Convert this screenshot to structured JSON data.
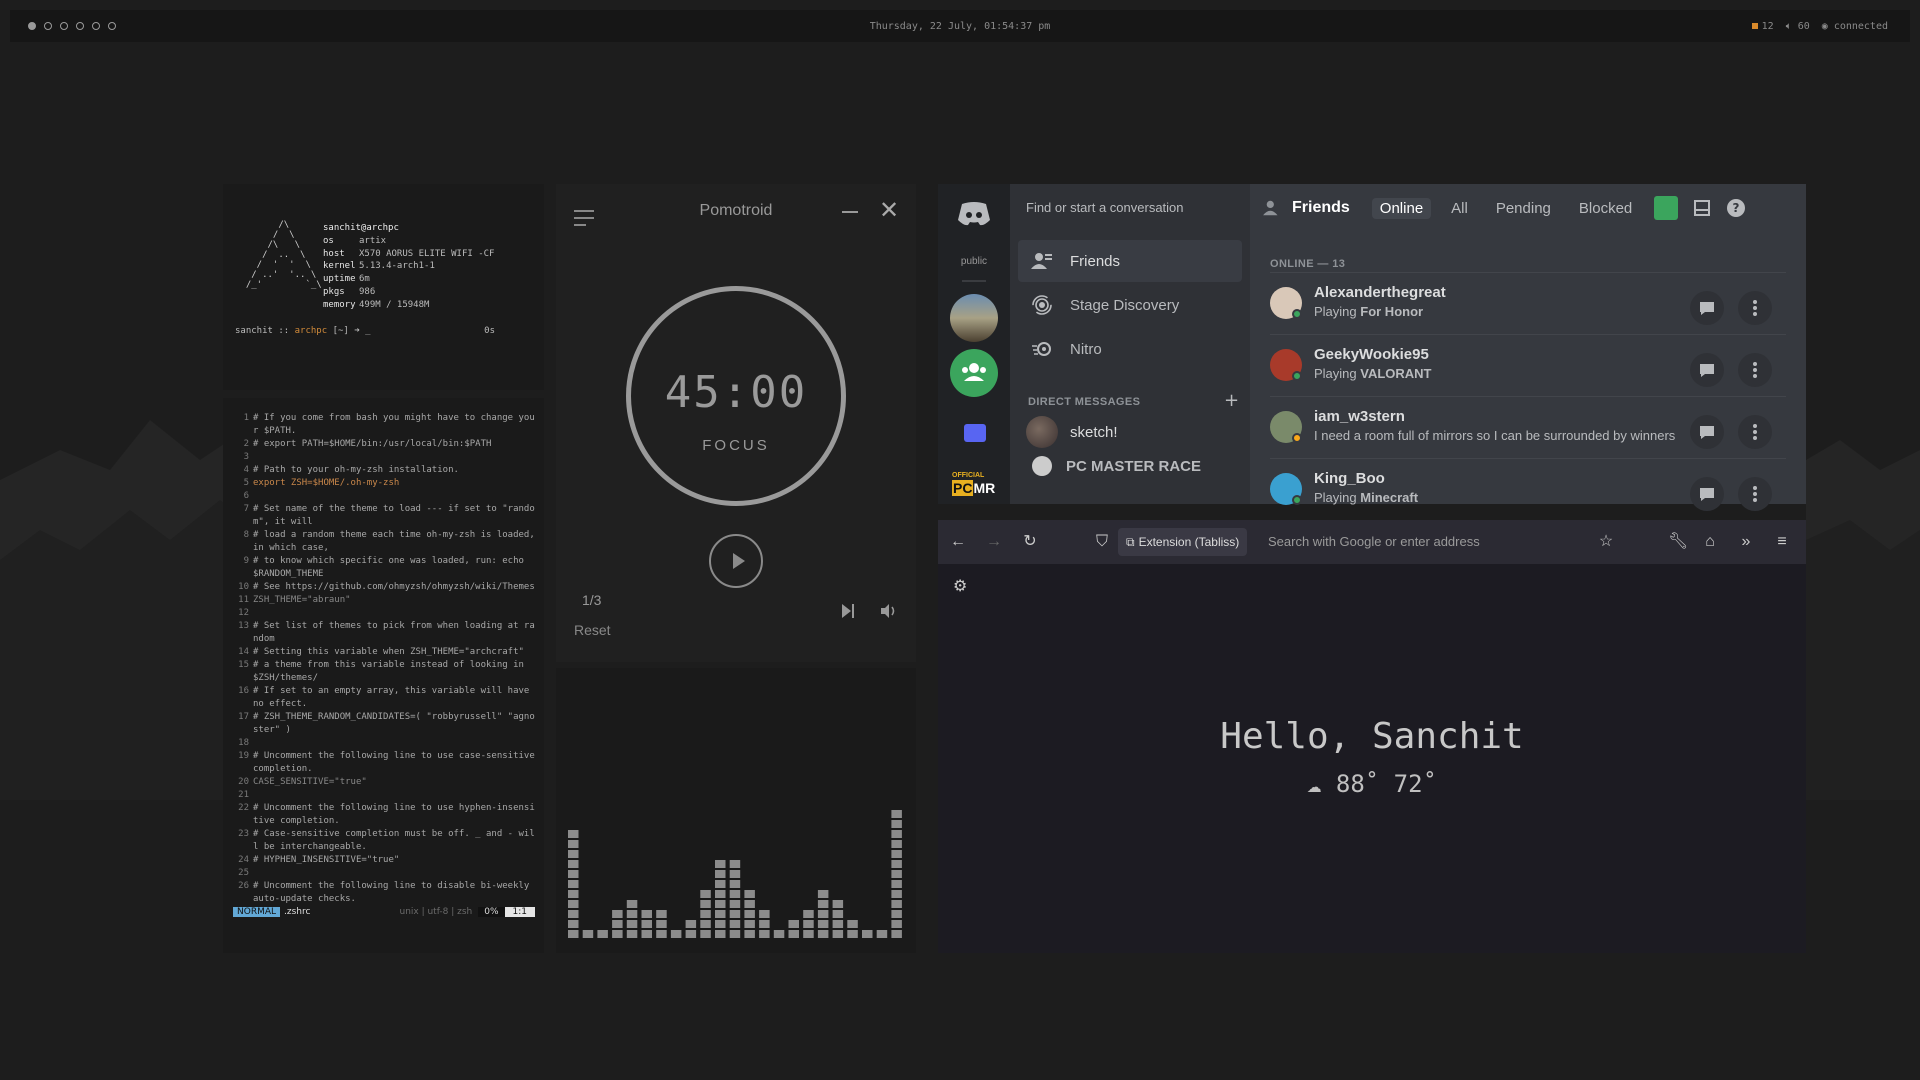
{
  "topbar": {
    "datetime": "Thursday, 22 July, 01:54:37 pm",
    "tray": {
      "updates": "12",
      "volume": "60",
      "network": "connected"
    },
    "workspaces": [
      {
        "active": true
      },
      {
        "active": false
      },
      {
        "active": false
      },
      {
        "active": false
      },
      {
        "active": false
      },
      {
        "active": false
      }
    ]
  },
  "neofetch": {
    "user": "sanchit@archpc",
    "info": [
      {
        "key": "os",
        "value": "artix"
      },
      {
        "key": "host",
        "value": "X570 AORUS ELITE WIFI -CF"
      },
      {
        "key": "kernel",
        "value": "5.13.4-arch1-1"
      },
      {
        "key": "uptime",
        "value": "6m"
      },
      {
        "key": "pkgs",
        "value": "986"
      },
      {
        "key": "memory",
        "value": "499M / 15948M"
      }
    ],
    "prompt_user": "sanchit",
    "prompt_sep": "::",
    "prompt_host": "archpc",
    "prompt_dir": "[~] ➜ _",
    "prompt_time": "0s"
  },
  "vim": {
    "lines": [
      {
        "n": "1",
        "t": "# If you come from bash you might have to change your $PATH.",
        "c": "comment"
      },
      {
        "n": "2",
        "t": "# export PATH=$HOME/bin:/usr/local/bin:$PATH",
        "c": "comment"
      },
      {
        "n": "3",
        "t": "",
        "c": "comment"
      },
      {
        "n": "4",
        "t": "# Path to your oh-my-zsh installation.",
        "c": "comment"
      },
      {
        "n": "5",
        "t": "export ZSH=$HOME/.oh-my-zsh",
        "c": "code"
      },
      {
        "n": "6",
        "t": "",
        "c": "comment"
      },
      {
        "n": "7",
        "t": "# Set name of the theme to load --- if set to \"random\", it will",
        "c": "comment"
      },
      {
        "n": "8",
        "t": "# load a random theme each time oh-my-zsh is loaded, in which case,",
        "c": "comment"
      },
      {
        "n": "9",
        "t": "# to know which specific one was loaded, run: echo $RANDOM_THEME",
        "c": "comment"
      },
      {
        "n": "10",
        "t": "# See https://github.com/ohmyzsh/ohmyzsh/wiki/Themes",
        "c": "comment"
      },
      {
        "n": "11",
        "t": "ZSH_THEME=\"abraun\"",
        "c": "str"
      },
      {
        "n": "12",
        "t": "",
        "c": "comment"
      },
      {
        "n": "13",
        "t": "# Set list of themes to pick from when loading at random",
        "c": "comment"
      },
      {
        "n": "14",
        "t": "# Setting this variable when ZSH_THEME=\"archcraft\"",
        "c": "comment"
      },
      {
        "n": "15",
        "t": "# a theme from this variable instead of looking in $ZSH/themes/",
        "c": "comment"
      },
      {
        "n": "16",
        "t": "# If set to an empty array, this variable will have no effect.",
        "c": "comment"
      },
      {
        "n": "17",
        "t": "# ZSH_THEME_RANDOM_CANDIDATES=( \"robbyrussell\" \"agnoster\" )",
        "c": "comment"
      },
      {
        "n": "18",
        "t": "",
        "c": "comment"
      },
      {
        "n": "19",
        "t": "# Uncomment the following line to use case-sensitive completion.",
        "c": "comment"
      },
      {
        "n": "20",
        "t": "CASE_SENSITIVE=\"true\"",
        "c": "str"
      },
      {
        "n": "21",
        "t": "",
        "c": "comment"
      },
      {
        "n": "22",
        "t": "# Uncomment the following line to use hyphen-insensitive completion.",
        "c": "comment"
      },
      {
        "n": "23",
        "t": "# Case-sensitive completion must be off. _ and - will be interchangeable.",
        "c": "comment"
      },
      {
        "n": "24",
        "t": "# HYPHEN_INSENSITIVE=\"true\"",
        "c": "comment"
      },
      {
        "n": "25",
        "t": "",
        "c": "comment"
      },
      {
        "n": "26",
        "t": "# Uncomment the following line to disable bi-weekly auto-update checks.",
        "c": "comment"
      }
    ],
    "status": {
      "mode": "NORMAL",
      "file": ".zshrc",
      "enc": "unix | utf-8 | zsh",
      "pct": "0%",
      "pos": "1:1"
    }
  },
  "pomotroid": {
    "title": "Pomotroid",
    "time": "45:00",
    "label": "FOCUS",
    "round": "1/3",
    "reset": "Reset"
  },
  "visualizer": {
    "levels": [
      11,
      1,
      1,
      3,
      4,
      3,
      3,
      1,
      2,
      5,
      8,
      8,
      5,
      3,
      1,
      2,
      3,
      5,
      4,
      2,
      1,
      1,
      13
    ]
  },
  "discord": {
    "server_label": "public",
    "search": "Find or start a conversation",
    "nav": [
      {
        "label": "Friends",
        "icon": "friends-icon"
      },
      {
        "label": "Stage Discovery",
        "icon": "stage-icon"
      },
      {
        "label": "Nitro",
        "icon": "nitro-icon"
      }
    ],
    "dm_header": "DIRECT MESSAGES",
    "dms": [
      {
        "name": "sketch!"
      },
      {
        "name": "PC MASTER RACE"
      }
    ],
    "pcmr": {
      "top": "OFFICIAL",
      "pc": "PC",
      "mr": "MR"
    },
    "header": {
      "title": "Friends",
      "tabs": [
        "Online",
        "All",
        "Pending",
        "Blocked"
      ]
    },
    "online_label": "ONLINE — 13",
    "friends": [
      {
        "name": "Alexanderthegreat",
        "status_prefix": "Playing ",
        "status_bold": "For Honor",
        "status_plain": "",
        "dot": "#3ba55d"
      },
      {
        "name": "GeekyWookie95",
        "status_prefix": "Playing ",
        "status_bold": "VALORANT",
        "status_plain": "",
        "dot": "#3ba55d"
      },
      {
        "name": "iam_w3stern",
        "status_prefix": "",
        "status_bold": "",
        "status_plain": "I need a room full of mirrors so I can be surrounded by winners",
        "dot": "#faa81a"
      },
      {
        "name": "King_Boo",
        "status_prefix": "Playing ",
        "status_bold": "Minecraft",
        "status_plain": "",
        "dot": "#3ba55d"
      }
    ]
  },
  "firefox": {
    "extension": "Extension (Tabliss)",
    "url_placeholder": "Search with Google or enter address",
    "greeting": "Hello, Sanchit",
    "weather": "88˚ 72˚"
  }
}
